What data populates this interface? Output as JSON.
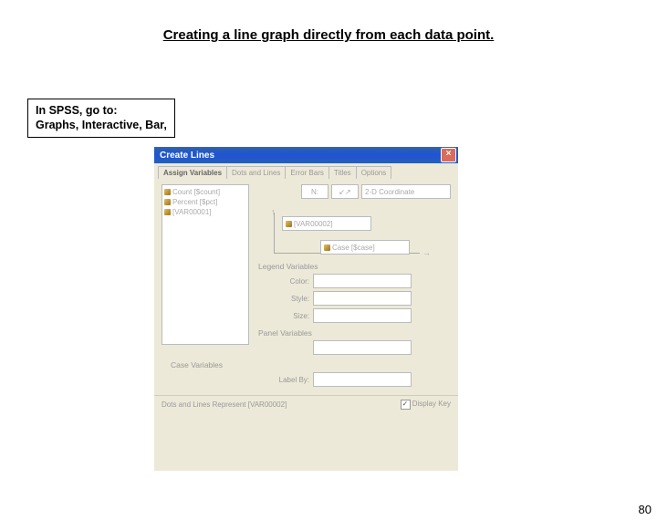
{
  "slide": {
    "title": "Creating a line graph directly from each data point.",
    "instruction_line1": "In SPSS, go to:",
    "instruction_line2": "Graphs, Interactive, Bar,",
    "page_number": "80"
  },
  "window": {
    "title": "Create Lines",
    "tabs": [
      "Assign Variables",
      "Dots and Lines",
      "Error Bars",
      "Titles",
      "Options"
    ],
    "var_list": [
      "Count [$count]",
      "Percent [$pct]",
      "[VAR00001]"
    ],
    "coord_button": "N:",
    "coord_select": "2-D Coordinate",
    "y_field": "[VAR00002]",
    "x_field": "Case [$case]",
    "legend_title": "Legend Variables",
    "legend_color": "Color:",
    "legend_style": "Style:",
    "legend_size": "Size:",
    "panel_title": "Panel Variables",
    "case_title": "Case Variables",
    "label_by": "Label By:",
    "footer_label": "Dots and Lines Represent",
    "footer_value": "[VAR00002]",
    "display_key": "Display Key"
  }
}
